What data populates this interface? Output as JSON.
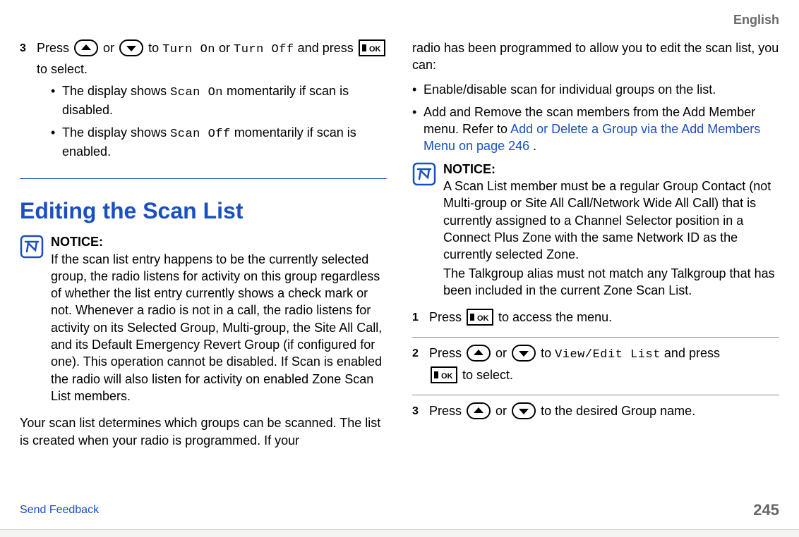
{
  "header": {
    "language": "English"
  },
  "left": {
    "step3": {
      "num": "3",
      "press1": "Press ",
      "or": " or ",
      "to": " to ",
      "turnOn": "Turn On",
      "orText": " or ",
      "turnOff": "Turn Off",
      "and": " and press ",
      "toSelect": " to select.",
      "bullet1_pre": "The display shows ",
      "scanOn": "Scan On",
      "bullet1_post": " momentarily if scan is disabled.",
      "bullet2_pre": "The display shows ",
      "scanOff": "Scan Off",
      "bullet2_post": " momentarily if scan is enabled."
    },
    "sectionTitle": "Editing the Scan List",
    "notice": {
      "label": "NOTICE:",
      "body": "If the scan list entry happens to be the currently selected group, the radio listens for activity on this group regardless of whether the list entry currently shows a check mark or not. Whenever a radio is not in a call, the radio listens for activity on its Selected Group, Multi-group, the Site All Call, and its Default Emergency Revert Group (if configured for one). This operation cannot be disabled. If Scan is enabled the radio will also listen for activity on enabled Zone Scan List members."
    },
    "para": "Your scan list determines which groups can be scanned. The list is created when your radio is programmed. If your"
  },
  "right": {
    "continued": "radio has been programmed to allow you to edit the scan list, you can:",
    "bullet1": "Enable/disable scan for individual groups on the list.",
    "bullet2_pre": "Add and Remove the scan members from the Add Member menu. Refer to ",
    "bullet2_link": "Add or Delete a Group via the Add Members Menu on page 246",
    "bullet2_post": ".",
    "notice": {
      "label": "NOTICE:",
      "body1": "A Scan List member must be a regular Group Contact (not Multi-group or Site All Call/Network Wide All Call) that is currently assigned to a Channel Selector position in a Connect Plus Zone with the same Network ID as the currently selected Zone.",
      "body2": "The Talkgroup alias must not match any Talkgroup that has been included in the current Zone Scan List."
    },
    "step1": {
      "num": "1",
      "press": "Press ",
      "toAccess": " to access the menu."
    },
    "step2": {
      "num": "2",
      "press": "Press ",
      "or": " or ",
      "to": " to ",
      "viewEdit": "View/Edit List",
      "andPress": " and press ",
      "toSelect": " to select."
    },
    "step3b": {
      "num": "3",
      "press": "Press ",
      "or": " or ",
      "toDesired": " to the desired Group name."
    }
  },
  "footer": {
    "feedback": "Send Feedback",
    "pageNum": "245"
  }
}
